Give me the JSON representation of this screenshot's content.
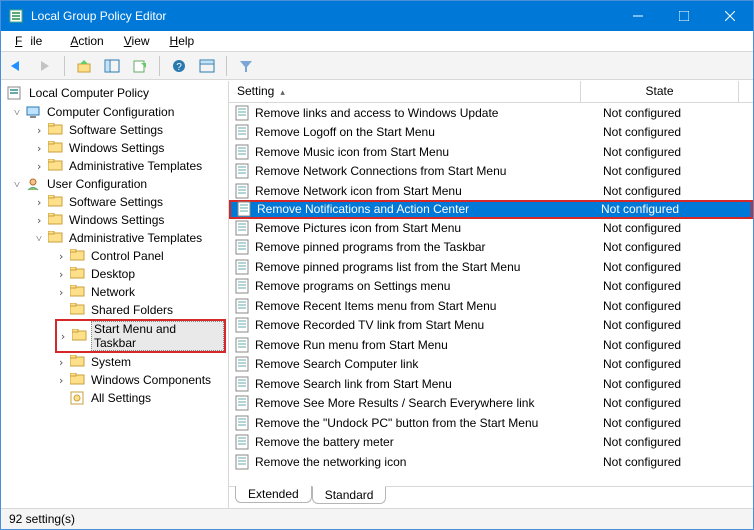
{
  "window": {
    "title": "Local Group Policy Editor"
  },
  "menu": {
    "file": "File",
    "action": "Action",
    "view": "View",
    "help": "Help"
  },
  "tree": {
    "root": "Local Computer Policy",
    "computer": "Computer Configuration",
    "user": "User Configuration",
    "software": "Software Settings",
    "windows": "Windows Settings",
    "adm": "Administrative Templates",
    "cp": "Control Panel",
    "desktop": "Desktop",
    "network": "Network",
    "shared": "Shared Folders",
    "start": "Start Menu and Taskbar",
    "system": "System",
    "wincomp": "Windows Components",
    "allset": "All Settings"
  },
  "list": {
    "col_setting": "Setting",
    "col_state": "State",
    "items": [
      {
        "label": "Remove links and access to Windows Update",
        "state": "Not configured",
        "selected": false
      },
      {
        "label": "Remove Logoff on the Start Menu",
        "state": "Not configured",
        "selected": false
      },
      {
        "label": "Remove Music icon from Start Menu",
        "state": "Not configured",
        "selected": false
      },
      {
        "label": "Remove Network Connections from Start Menu",
        "state": "Not configured",
        "selected": false
      },
      {
        "label": "Remove Network icon from Start Menu",
        "state": "Not configured",
        "selected": false
      },
      {
        "label": "Remove Notifications and Action Center",
        "state": "Not configured",
        "selected": true
      },
      {
        "label": "Remove Pictures icon from Start Menu",
        "state": "Not configured",
        "selected": false
      },
      {
        "label": "Remove pinned programs from the Taskbar",
        "state": "Not configured",
        "selected": false
      },
      {
        "label": "Remove pinned programs list from the Start Menu",
        "state": "Not configured",
        "selected": false
      },
      {
        "label": "Remove programs on Settings menu",
        "state": "Not configured",
        "selected": false
      },
      {
        "label": "Remove Recent Items menu from Start Menu",
        "state": "Not configured",
        "selected": false
      },
      {
        "label": "Remove Recorded TV link from Start Menu",
        "state": "Not configured",
        "selected": false
      },
      {
        "label": "Remove Run menu from Start Menu",
        "state": "Not configured",
        "selected": false
      },
      {
        "label": "Remove Search Computer link",
        "state": "Not configured",
        "selected": false
      },
      {
        "label": "Remove Search link from Start Menu",
        "state": "Not configured",
        "selected": false
      },
      {
        "label": "Remove See More Results / Search Everywhere link",
        "state": "Not configured",
        "selected": false
      },
      {
        "label": "Remove the \"Undock PC\" button from the Start Menu",
        "state": "Not configured",
        "selected": false
      },
      {
        "label": "Remove the battery meter",
        "state": "Not configured",
        "selected": false
      },
      {
        "label": "Remove the networking icon",
        "state": "Not configured",
        "selected": false
      }
    ]
  },
  "tabs": {
    "extended": "Extended",
    "standard": "Standard"
  },
  "status": {
    "text": "92 setting(s)"
  }
}
